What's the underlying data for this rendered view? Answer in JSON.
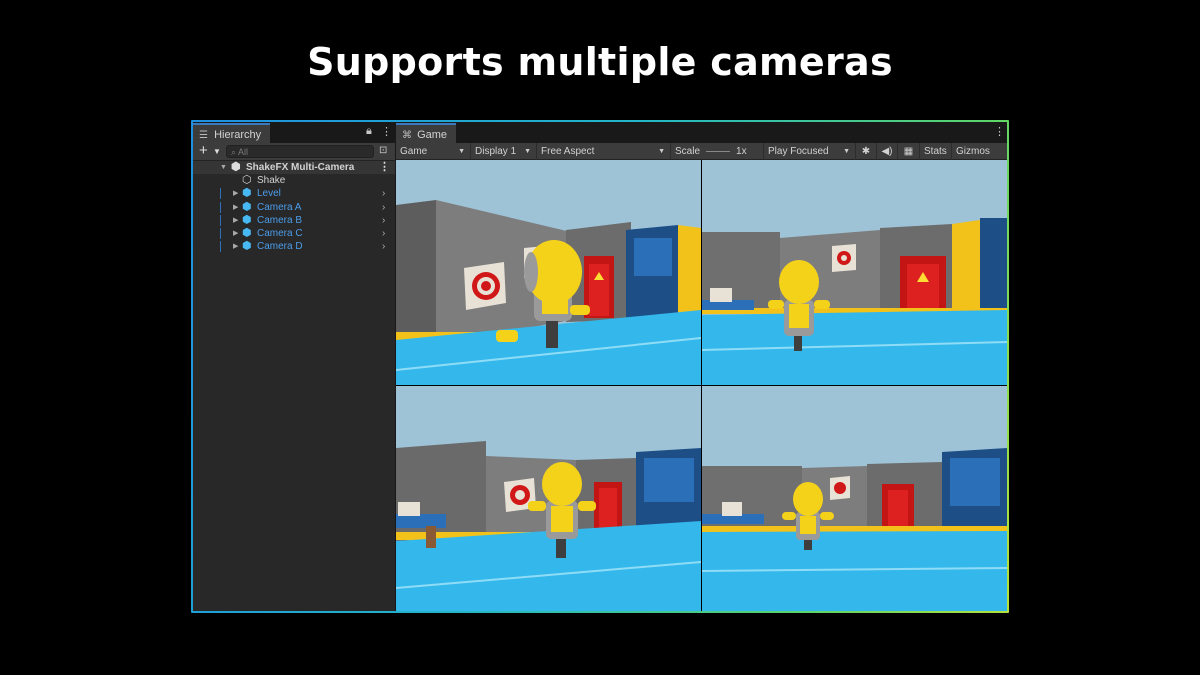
{
  "headline": "Supports multiple cameras",
  "hierarchy": {
    "tab_label": "Hierarchy",
    "search_placeholder": "All",
    "scene": {
      "name": "ShakeFX Multi-Camera"
    },
    "items": [
      {
        "label": "Shake",
        "prefab": false
      },
      {
        "label": "Level",
        "prefab": true
      },
      {
        "label": "Camera A",
        "prefab": true
      },
      {
        "label": "Camera B",
        "prefab": true
      },
      {
        "label": "Camera C",
        "prefab": true
      },
      {
        "label": "Camera D",
        "prefab": true
      }
    ]
  },
  "game": {
    "tab_label": "Game",
    "toolbar": {
      "mode": "Game",
      "display": "Display 1",
      "aspect": "Free Aspect",
      "scale_label": "Scale",
      "scale_value": "1x",
      "play_mode": "Play Focused",
      "stats": "Stats",
      "gizmos": "Gizmos"
    },
    "views": [
      "camera-a-view",
      "camera-b-view",
      "camera-c-view",
      "camera-d-view"
    ]
  },
  "colors": {
    "frame_gradient": [
      "#1f8fe0",
      "#22b7c8",
      "#5bd56a",
      "#b4e23c"
    ],
    "prefab_blue": "#4b9dea",
    "floor": "#2eb6ea",
    "robot_yellow": "#f5d21a"
  },
  "icons": [
    "hierarchy-icon",
    "lock-icon",
    "kebab-menu-icon",
    "plus-icon",
    "search-icon",
    "scene-icon",
    "gameobject-cube-icon",
    "prefab-cube-icon",
    "gamepad-icon",
    "bug-icon",
    "speaker-icon",
    "keyboard-icon"
  ]
}
